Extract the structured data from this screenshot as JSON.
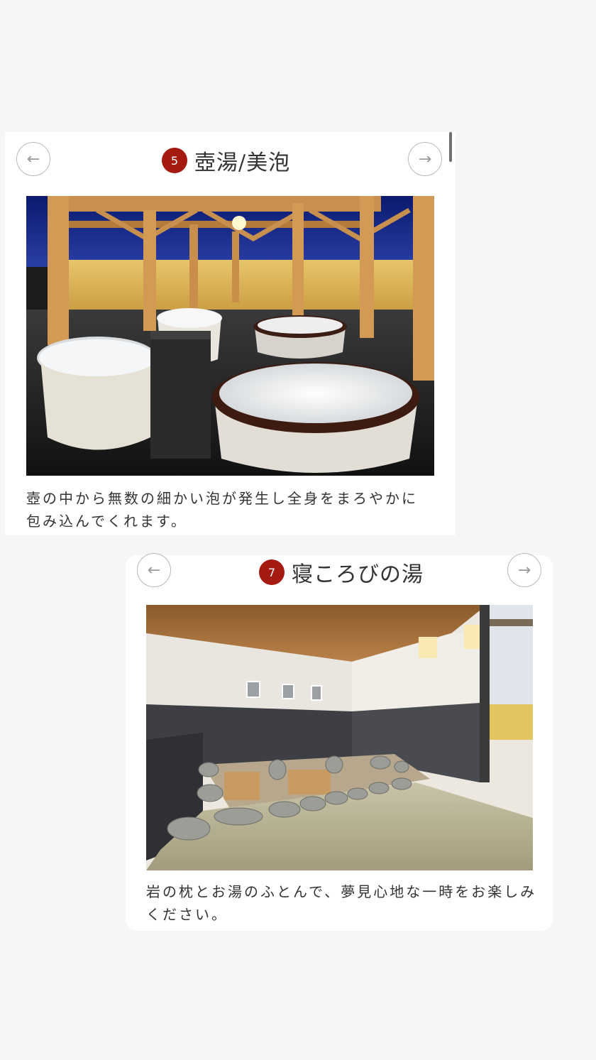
{
  "cards": [
    {
      "number": "5",
      "title": "壺湯/美泡",
      "prev_icon": "arrow-left-icon",
      "next_icon": "arrow-right-icon",
      "prev_glyph": "←",
      "next_glyph": "→",
      "photo": "outdoor-jar-baths-photo",
      "description_line1": "壺の中から無数の細かい泡が発生し全身をまろやかに",
      "description_line2": "包み込んでくれます。"
    },
    {
      "number": "7",
      "title": "寝ころびの湯",
      "prev_icon": "arrow-left-icon",
      "next_icon": "arrow-right-icon",
      "prev_glyph": "←",
      "next_glyph": "→",
      "photo": "rock-pillow-bath-photo",
      "description_line1": "岩の枕とお湯のふとんで、夢見心地な一時をお楽しみ",
      "description_line2": "ください。"
    }
  ],
  "colors": {
    "badge": "#a51b12",
    "page_background": "#f7f6f6",
    "card_background": "#ffffff",
    "nav_border": "#b9b9b9"
  }
}
